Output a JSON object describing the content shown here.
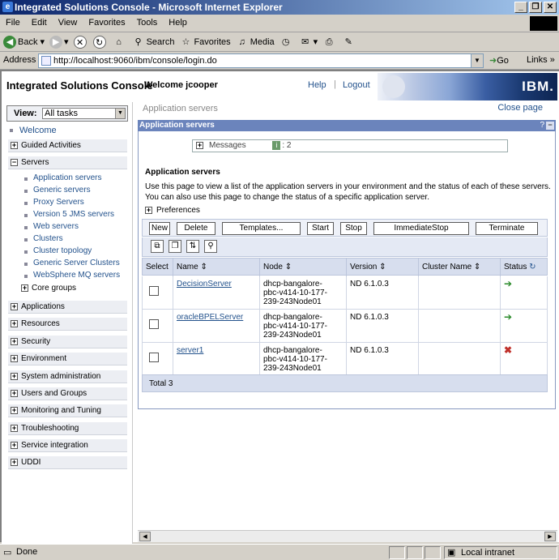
{
  "window": {
    "title": "Integrated Solutions Console - Microsoft Internet Explorer"
  },
  "menu": [
    "File",
    "Edit",
    "View",
    "Favorites",
    "Tools",
    "Help"
  ],
  "toolbar": {
    "back": "Back",
    "search": "Search",
    "favorites": "Favorites",
    "media": "Media"
  },
  "address": {
    "label": "Address",
    "url": "http://localhost:9060/ibm/console/login.do",
    "go": "Go",
    "links": "Links"
  },
  "header": {
    "product": "Integrated Solutions Console",
    "welcome": "Welcome jcooper",
    "help": "Help",
    "logout": "Logout",
    "brand": "IBM."
  },
  "nav": {
    "view_label": "View:",
    "view_value": "All tasks",
    "welcome": "Welcome",
    "guided": "Guided Activities",
    "servers": "Servers",
    "server_items": [
      "Application servers",
      "Generic servers",
      "Proxy Servers",
      "Version 5 JMS servers",
      "Web servers",
      "Clusters",
      "Cluster topology",
      "Generic Server Clusters",
      "WebSphere MQ servers"
    ],
    "core_groups": "Core groups",
    "categories": [
      "Applications",
      "Resources",
      "Security",
      "Environment",
      "System administration",
      "Users and Groups",
      "Monitoring and Tuning",
      "Troubleshooting",
      "Service integration",
      "UDDI"
    ]
  },
  "main": {
    "breadcrumb": "Application servers",
    "close_page": "Close page",
    "portlet_title": "Application servers",
    "help_q": "?",
    "messages_label": "Messages",
    "messages_count": ": 2",
    "section_title": "Application servers",
    "description": "Use this page to view a list of the application servers in your environment and the status of each of these servers. You can also use this page to change the status of a specific application server.",
    "preferences": "Preferences",
    "buttons": [
      "New",
      "Delete",
      "Templates...",
      "Start",
      "Stop",
      "ImmediateStop",
      "Terminate"
    ],
    "columns": {
      "select": "Select",
      "name": "Name",
      "node": "Node",
      "version": "Version",
      "cluster": "Cluster Name",
      "status": "Status"
    },
    "rows": [
      {
        "name": "DecisionServer",
        "node_l1": "dhcp-bangalore-",
        "node_l2": "pbc-v414-10-177-",
        "node_l3": "239-243Node01",
        "version": "ND 6.1.0.3",
        "status": "started"
      },
      {
        "name": "oracleBPELServer",
        "node_l1": "dhcp-bangalore-",
        "node_l2": "pbc-v414-10-177-",
        "node_l3": "239-243Node01",
        "version": "ND 6.1.0.3",
        "status": "started"
      },
      {
        "name": "server1",
        "node_l1": "dhcp-bangalore-",
        "node_l2": "pbc-v414-10-177-",
        "node_l3": "239-243Node01",
        "version": "ND 6.1.0.3",
        "status": "stopped"
      }
    ],
    "total": "Total 3"
  },
  "statusbar": {
    "text": "Done",
    "zone": "Local intranet"
  },
  "colors": {
    "titlebar": "#0a246a",
    "portlet_title": "#6b84bc",
    "link": "#23528c",
    "started": "#2a8a2a",
    "stopped": "#c0302a"
  }
}
